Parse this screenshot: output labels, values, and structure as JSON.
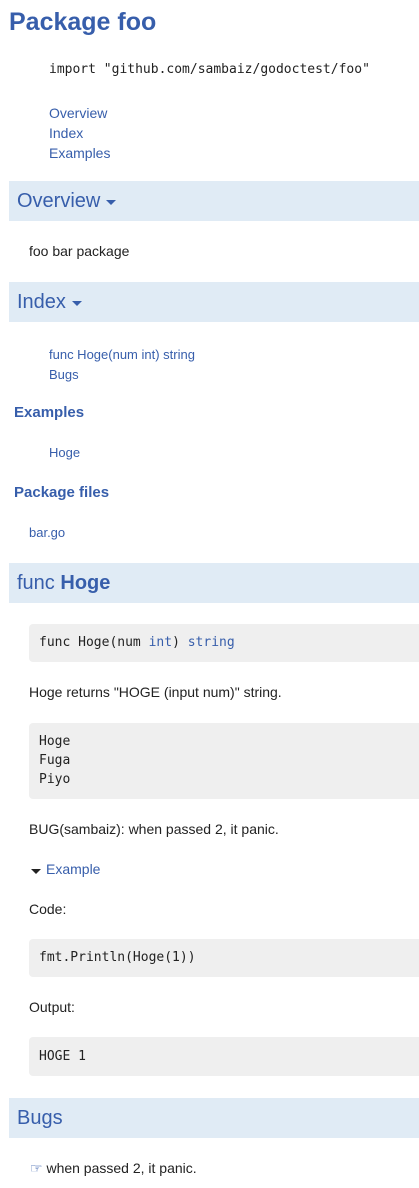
{
  "page": {
    "title": "Package foo",
    "import_line": "import \"github.com/sambaiz/godoctest/foo\"",
    "toc": [
      "Overview",
      "Index",
      "Examples"
    ]
  },
  "overview": {
    "heading": "Overview",
    "text": "foo bar package"
  },
  "index": {
    "heading": "Index",
    "items": [
      "func Hoge(num int) string",
      "Bugs"
    ],
    "examples_heading": "Examples",
    "examples": [
      "Hoge"
    ],
    "files_heading": "Package files",
    "files": [
      "bar.go"
    ]
  },
  "func_hoge": {
    "heading_prefix": "func",
    "heading_name": "Hoge",
    "signature": {
      "prefix": "func Hoge(num ",
      "param_type": "int",
      "mid": ") ",
      "return_type": "string"
    },
    "description": "Hoge returns \"HOGE (input num)\" string.",
    "list_block": [
      "Hoge",
      "Fuga",
      "Piyo"
    ],
    "bug_note": "BUG(sambaiz): when passed 2, it panic.",
    "example": {
      "toggle_label": "Example",
      "code_label": "Code:",
      "code": "fmt.Println(Hoge(1))",
      "output_label": "Output:",
      "output": "HOGE 1"
    }
  },
  "bugs": {
    "heading": "Bugs",
    "icon": "pointing-hand-icon",
    "items": [
      "when passed 2, it panic."
    ]
  }
}
